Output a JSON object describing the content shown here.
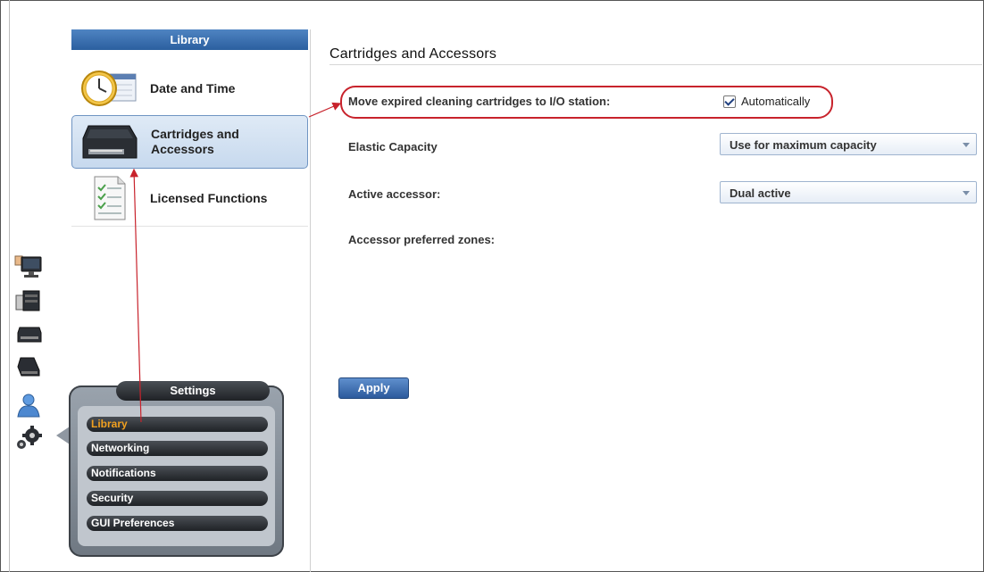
{
  "library": {
    "header": "Library",
    "items": [
      {
        "label": "Date and Time",
        "icon": "clock-icon"
      },
      {
        "label": "Cartridges and\nAccessors",
        "icon": "tape-drive-icon",
        "active": true
      },
      {
        "label": "Licensed Functions",
        "icon": "document-icon"
      }
    ]
  },
  "content": {
    "title": "Cartridges and Accessors",
    "move_expired_label": "Move expired cleaning cartridges to I/O station:",
    "automatically_label": "Automatically",
    "elastic_capacity_label": "Elastic Capacity",
    "elastic_capacity_value": "Use for maximum capacity",
    "active_accessor_label": "Active accessor:",
    "active_accessor_value": "Dual active",
    "preferred_zones_label": "Accessor preferred zones:",
    "apply_label": "Apply"
  },
  "settings": {
    "title": "Settings",
    "items": [
      "Library",
      "Networking",
      "Notifications",
      "Security",
      "GUI Preferences"
    ],
    "active": "Library"
  },
  "rail_icons": [
    "monitor-icon",
    "library-frame-icon",
    "tape-drive-icon",
    "cartridge-icon",
    "user-icon",
    "gear-icon"
  ],
  "colors": {
    "accent": "#2b5f9f",
    "annotation": "#c8232c",
    "active_setting": "#f0a020"
  }
}
